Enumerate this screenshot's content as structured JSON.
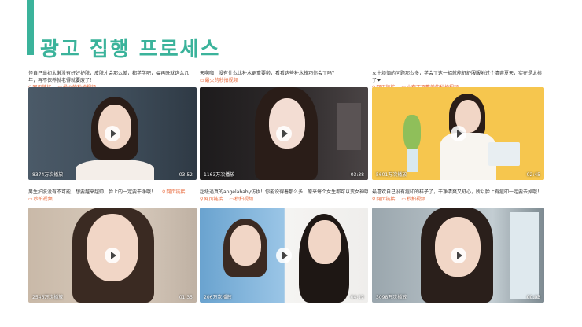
{
  "page": {
    "title": "광고 집행 프로세스",
    "accent": "#3bb39b"
  },
  "link_labels": {
    "page_link": "网页链接"
  },
  "cards": [
    {
      "caption": "怪自己当初太懒没有好好护肤，皮肤才会那么差，都学学吧，😀再晚就这么几年，再不保养就老得就要废了！",
      "tag": "最火的秒拍视频",
      "views": "8374万次播放",
      "duration": "03:52"
    },
    {
      "caption": "天啊咖，没有什么比补水更重要啦，看看这些补水技巧你会了吗？",
      "tag": "最火的秒拍视频",
      "views": "1163万次播放",
      "duration": "03:38"
    },
    {
      "caption": "女生烦恼的问题那么多，学会了这一招就能舒舒服服地过个清爽夏天，实在是太棒了❤",
      "tag": "小布丁不戴美的秒拍视频",
      "views": "5601万次播放",
      "duration": "02:45"
    },
    {
      "caption": "男生护肤没有不可能，想要越来越帅，脸上的一定要干净哦！！",
      "tag": "秒拍视频",
      "views": "2546万次播放",
      "duration": "01:35"
    },
    {
      "caption": "超级逼真的angelababy仿妆！你能说得着那么多，原来每个女生都可以变女神哦～！",
      "tag": "秒拍视频",
      "views": "206万次播放",
      "duration": "04:12"
    },
    {
      "caption": "最喜欢自己没有痘印的样子了，干净清爽又舒心，所以脸上有痘印一定要去掉哦！",
      "tag": "秒拍视频",
      "views": "3098万次播放",
      "duration": "00:03"
    }
  ]
}
